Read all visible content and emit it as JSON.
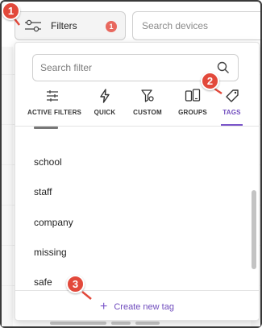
{
  "toolbar": {
    "filters_label": "Filters",
    "filters_badge": "1",
    "search_devices_placeholder": "Search devices"
  },
  "popover": {
    "search_placeholder": "Search filter",
    "tabs": [
      {
        "label": "ACTIVE FILTERS",
        "icon": "sliders-icon",
        "active": false
      },
      {
        "label": "QUICK",
        "icon": "lightning-icon",
        "active": false
      },
      {
        "label": "CUSTOM",
        "icon": "custom-filter-icon",
        "active": false
      },
      {
        "label": "GROUPS",
        "icon": "devices-group-icon",
        "active": false
      },
      {
        "label": "TAGS",
        "icon": "tag-icon",
        "active": true
      }
    ],
    "tag_items": [
      "school",
      "staff",
      "company",
      "missing",
      "safe"
    ],
    "create_label": "Create new tag"
  },
  "callouts": [
    "1",
    "2",
    "3"
  ],
  "colors": {
    "accent": "#6f4bbd",
    "callout": "#e2493b",
    "badge": "#e8685e"
  }
}
